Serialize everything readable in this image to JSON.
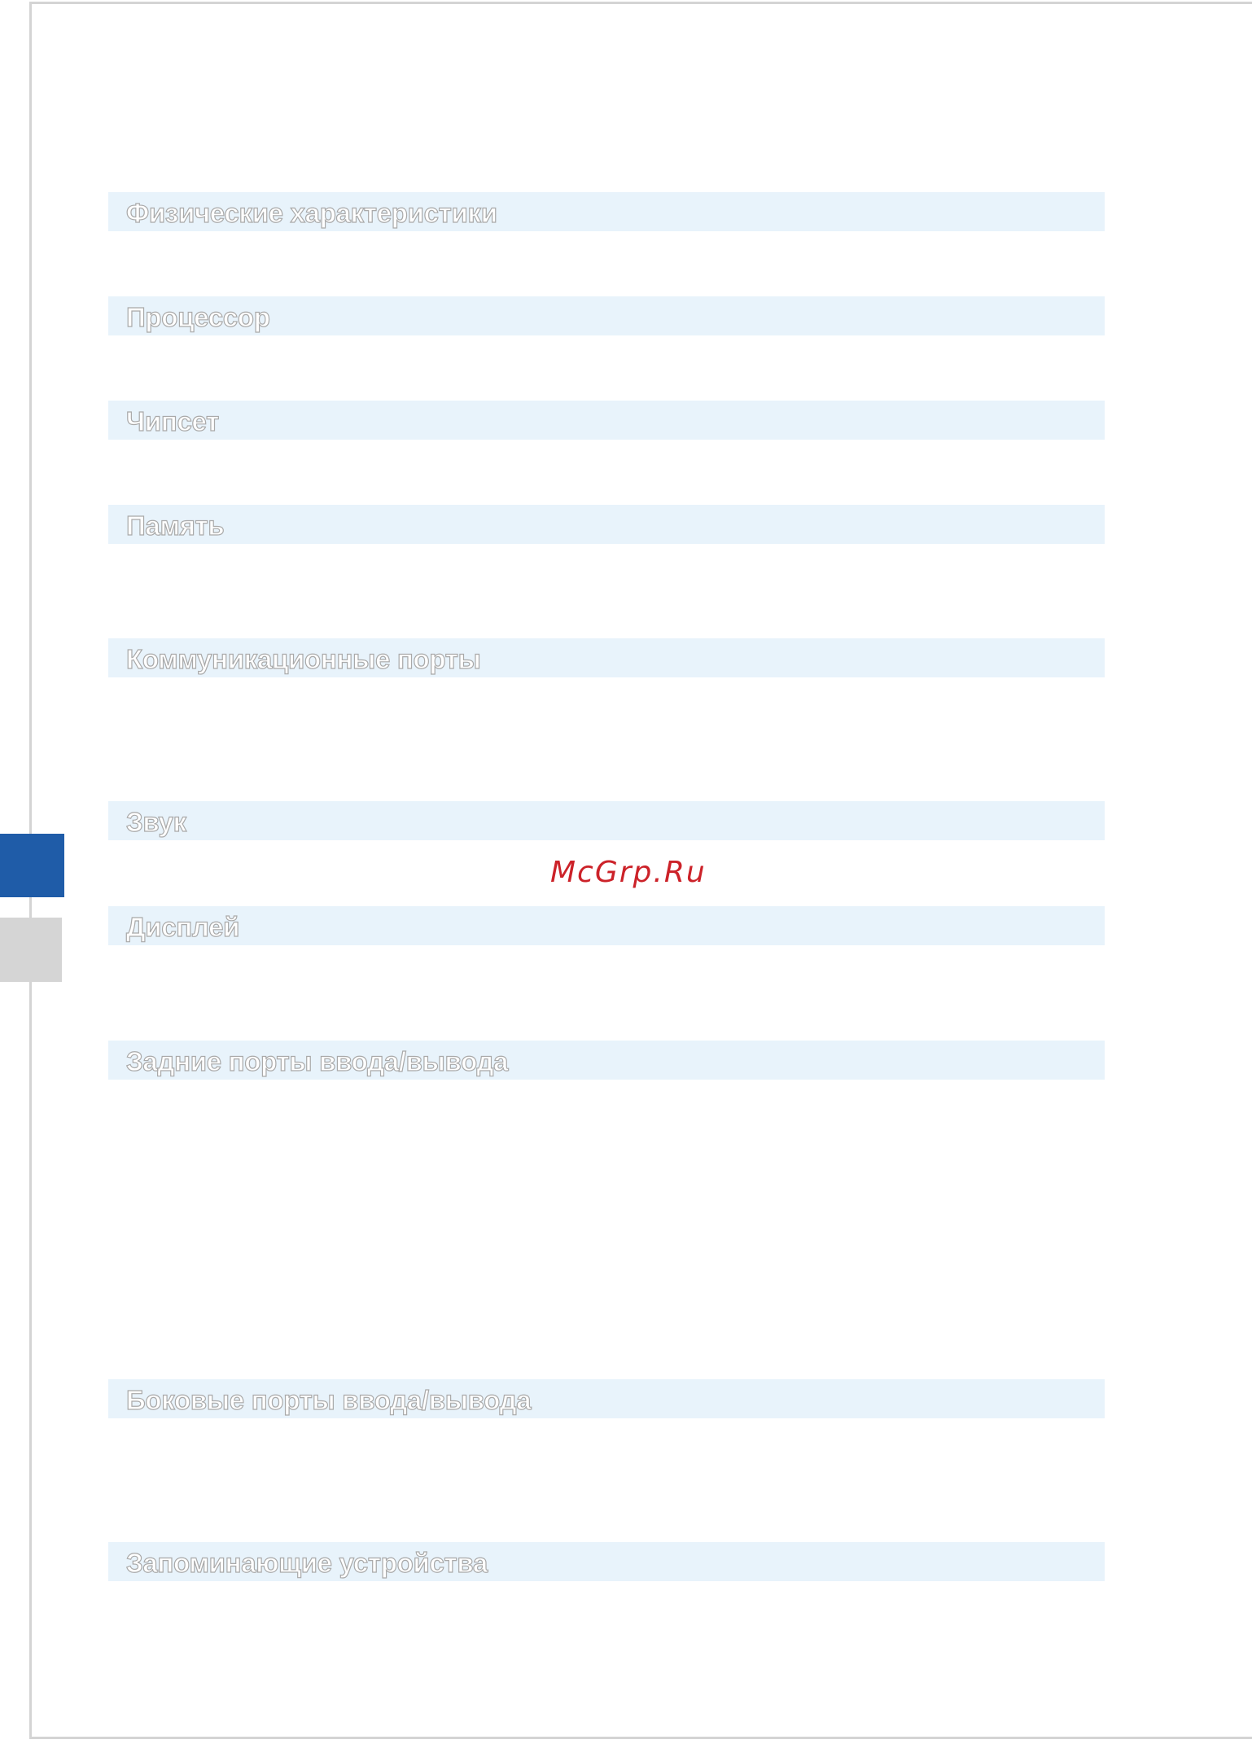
{
  "sections": [
    {
      "title": "Физические характеристики"
    },
    {
      "title": "Процессор"
    },
    {
      "title": "Чипсет"
    },
    {
      "title": "Память"
    },
    {
      "title": "Коммуникационные порты"
    },
    {
      "title": "Звук"
    },
    {
      "title": "Дисплей"
    },
    {
      "title": "Задние порты ввода/вывода"
    },
    {
      "title": "Боковые порты ввода/вывода"
    },
    {
      "title": "Запоминающие устройства"
    }
  ],
  "watermark": "McGrp.Ru",
  "colors": {
    "section_bar": "#e8f3fb",
    "side_tab_active": "#1f5ca8",
    "side_tab_inactive": "#d5d5d5",
    "watermark": "#cc2229",
    "frame": "#d4d4d4"
  }
}
